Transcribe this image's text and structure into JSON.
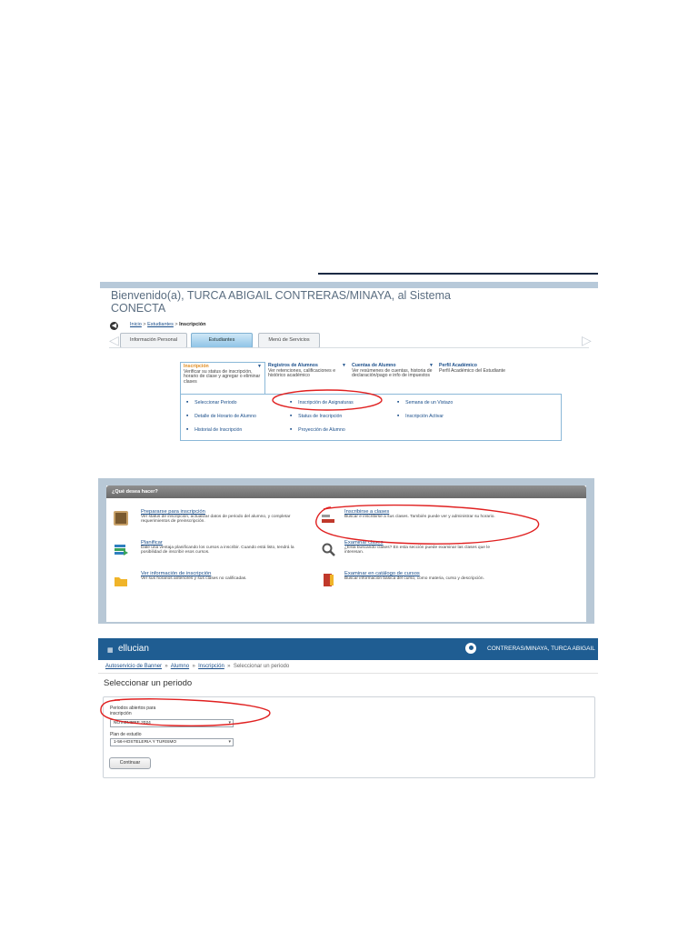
{
  "panel1": {
    "welcome": "Bienvenido(a), TURCA ABIGAIL CONTRERAS/MINAYA, al Sistema CONECTA",
    "breadcrumb": {
      "home": "Inicio",
      "students": "Estudiantes",
      "current": "Inscripción",
      "sep": ">"
    },
    "tabs": [
      {
        "label": "Información Personal"
      },
      {
        "label": "Estudiantes"
      },
      {
        "label": "Menú de Servicios"
      }
    ],
    "menu_columns": [
      {
        "title": "Inscripción",
        "desc": "Verificar su status de inscripción, horario de clase y agregar o eliminar clases"
      },
      {
        "title": "Registros de Alumnos",
        "desc": "Ver retenciones, calificaciones e histórico académico"
      },
      {
        "title": "Cuentas de Alumno",
        "desc": "Ver resúmenes de cuentas, historia de declaración/pago e info de impuestos"
      },
      {
        "title": "Perfil Académico",
        "desc": "Perfil Académico del Estudiante"
      }
    ],
    "submenu": [
      "Seleccionar Periodo",
      "Inscripción de Asignaturas",
      "Semana de un Vistazo",
      "Detalle de Horario de Alumno",
      "Status de Inscripción",
      "Inscripción Activar",
      "Historial de Inscripción",
      "Proyección de Alumno"
    ]
  },
  "panel2": {
    "header": "¿Qué desea hacer?",
    "options": [
      {
        "title": "Prepararse para inscripción",
        "desc": "Ver status de inscripción, actualizar datos de periodo del alumno, y completar requerimientos de preinscripción.",
        "icon": "clipboard-icon"
      },
      {
        "title": "Inscribirse a clases",
        "desc": "Buscar e inscribirse a sus clases. También puede ver y administrar su horario.",
        "icon": "pencil-icon"
      },
      {
        "title": "Planificar",
        "desc": "Dale una ventaja planificando los cursos a inscribir. Cuando está listo, tendrá la posibilidad de inscribir esos cursos.",
        "icon": "list-icon"
      },
      {
        "title": "Examinar clases",
        "desc": "¿Está buscando clases? En esta sección puede examinar las clases que le interesan.",
        "icon": "magnifier-icon"
      },
      {
        "title": "Ver información de inscripción",
        "desc": "Ver sus horarios anteriores y sus clases no calificadas.",
        "icon": "folder-icon"
      },
      {
        "title": "Examinar en catálogo de cursos",
        "desc": "Buscar información básica del curso, como materia, curso y descripción.",
        "icon": "book-icon"
      }
    ],
    "colors": {
      "red_icon": "#c0392b",
      "yellow_icon": "#f0b429"
    }
  },
  "panel3": {
    "brand": "ellucian",
    "user": "CONTRERAS/MINAYA, TURCA ABIGAIL",
    "breadcrumb": [
      {
        "label": "Autoservicio de Banner"
      },
      {
        "label": "Alumno"
      },
      {
        "label": "Inscripción"
      },
      {
        "label": "Seleccionar un periodo"
      }
    ],
    "breadcrumb_sep": "»",
    "page_title": "Seleccionar un periodo",
    "term_label_1": "Periodos abiertos para",
    "term_label_2": "inscripción",
    "term_value": "NOVIEMBRE 2024",
    "plan_label": "Plan de estudio",
    "plan_value": "1-56-HOSTELERIA Y TURISMO",
    "continue_label": "Continuar",
    "colors": {
      "topbar": "#1f5d92"
    }
  },
  "annotation_color": "#e02020"
}
